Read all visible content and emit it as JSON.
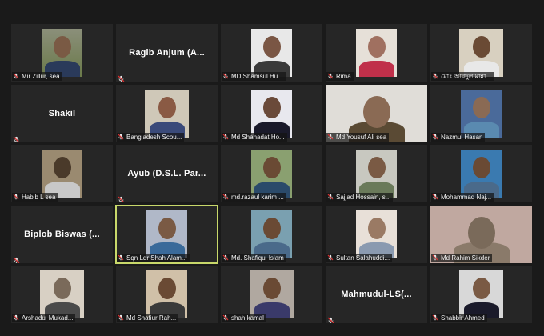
{
  "participants": [
    {
      "name": "Mir Zillur, sea",
      "video": "narrow",
      "bg": "#8b8f7a",
      "skin": "#7a5a44",
      "shirt": "#2a3a5a",
      "bgAccent": "#6b7a4a"
    },
    {
      "name": "Ragib Anjum (A...",
      "video": "none"
    },
    {
      "name": "MD.Shamsul Hu...",
      "video": "narrow",
      "bg": "#e8e8e8",
      "skin": "#7a5644",
      "shirt": "#3a3a3a"
    },
    {
      "name": "Rima",
      "video": "narrow",
      "bg": "#e6e0d8",
      "skin": "#a07060",
      "shirt": "#c0304a"
    },
    {
      "name": "মোঃ আবদুল মান্না...",
      "video": "mid",
      "bg": "#d8d0c0",
      "skin": "#6a4a34",
      "shirt": "#e8e8e8"
    },
    {
      "name": "Shakil",
      "video": "none",
      "centerOnly": true
    },
    {
      "name": "Bangladesh Scou...",
      "video": "mid",
      "bg": "#cfc8b8",
      "skin": "#8a5a44",
      "shirt": "#3a4a7a"
    },
    {
      "name": "Md Shahadat Ho...",
      "video": "narrow",
      "bg": "#e8e8ee",
      "skin": "#6a4a3a",
      "shirt": "#1a1a2a"
    },
    {
      "name": "Md Yousuf Ali sea",
      "video": "partial",
      "bg": "#e0ddd8",
      "skin": "#8a6a54",
      "shirt": "#5a4a34"
    },
    {
      "name": "Nazmul Hasan",
      "video": "narrow",
      "bg": "#4a6a9a",
      "skin": "#8a6a54",
      "shirt": "#5a8ab0"
    },
    {
      "name": "Habib L  sea",
      "video": "narrow",
      "bg": "#9a8a70",
      "skin": "#4a3a2a",
      "shirt": "#c8c8c8"
    },
    {
      "name": "Ayub (D.S.L. Par...",
      "video": "none"
    },
    {
      "name": "md.razaul karim ...",
      "video": "narrow",
      "bg": "#8aa070",
      "skin": "#6a4a34",
      "shirt": "#2a4a6a"
    },
    {
      "name": "Sajjad Hossain, s...",
      "video": "narrow",
      "bg": "#c8c8c0",
      "skin": "#7a5a44",
      "shirt": "#6a7a5a"
    },
    {
      "name": "Mohammad Naj...",
      "video": "narrow",
      "bg": "#3a7ab0",
      "skin": "#6a4a34",
      "shirt": "#4a6a8a"
    },
    {
      "name": "Biplob Biswas (...",
      "video": "none"
    },
    {
      "name": "Sqn Ldr Shah Alam...",
      "video": "narrow",
      "bg": "#b0b8c8",
      "skin": "#7a5a44",
      "shirt": "#3a6a9a",
      "active": true
    },
    {
      "name": "Md. Shafiqul Islam",
      "video": "narrow",
      "bg": "#7aa0b0",
      "skin": "#6a4a34",
      "shirt": "#4a6a8a"
    },
    {
      "name": "Sultan Salahuddi...",
      "video": "narrow",
      "bg": "#e8e0d8",
      "skin": "#9a7a64",
      "shirt": "#8a9ab0"
    },
    {
      "name": "Md Rahim Sikder",
      "video": "partial",
      "bg": "#c0a8a0",
      "skin": "#7a6a5a",
      "shirt": "#8a7a6a"
    },
    {
      "name": "Arshadul Mukad...",
      "video": "mid",
      "bg": "#d8d0c4",
      "skin": "#7a6a5a",
      "shirt": "#4a4a4a"
    },
    {
      "name": "Md Shafiur Rah...",
      "video": "narrow",
      "bg": "#d0c0a8",
      "skin": "#6a4a34",
      "shirt": "#3a3a3a"
    },
    {
      "name": "shah kamal",
      "video": "mid",
      "bg": "#b0a8a0",
      "skin": "#6a4a34",
      "shirt": "#3a3a6a"
    },
    {
      "name": "Mahmudul-LS(...",
      "video": "none"
    },
    {
      "name": "Shabbir Ahmed",
      "video": "mid",
      "bg": "#d8d8d8",
      "skin": "#7a5a44",
      "shirt": "#1a1a2a"
    }
  ],
  "colors": {
    "background": "#1a1a1a",
    "tile": "#262626",
    "activeBorder": "#c8d86a",
    "micMuted": "#e03030"
  }
}
